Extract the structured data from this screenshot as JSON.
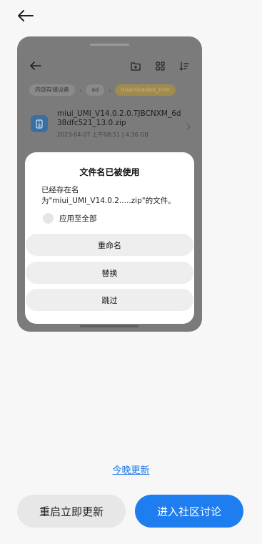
{
  "file_manager": {
    "breadcrumb": [
      "内部存储设备",
      "ad",
      "downloaded_rom"
    ],
    "file": {
      "name": "miui_UMI_V14.0.2.0.TJBCNXM_6d38dfc521_13.0.zip",
      "meta": "2023-04-07 上午08:51 | 4.36 GB"
    }
  },
  "dialog": {
    "title": "文件名已被使用",
    "message": "已经存在名为\"miui_UMI_V14.0.2.....zip\"的文件。",
    "apply_all_label": "应用至全部",
    "buttons": {
      "rename": "重命名",
      "replace": "替换",
      "skip": "跳过"
    }
  },
  "update": {
    "tonight_link": "今晚更新",
    "restart_button": "重启立即更新",
    "community_button": "进入社区讨论"
  },
  "colors": {
    "accent": "#1e7ef0",
    "link": "#1e78e6",
    "card_dim": "#7b7b7b"
  },
  "icons": [
    "back-arrow-icon",
    "new-folder-icon",
    "grid-view-icon",
    "sort-icon",
    "zip-file-icon",
    "chevron-right-icon"
  ]
}
